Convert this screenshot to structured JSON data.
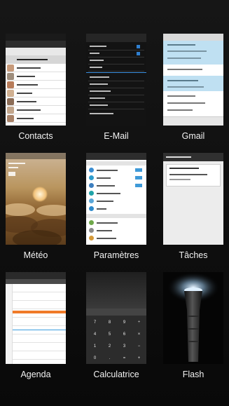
{
  "apps": [
    {
      "id": "contacts",
      "label": "Contacts"
    },
    {
      "id": "email",
      "label": "E-Mail"
    },
    {
      "id": "gmail",
      "label": "Gmail"
    },
    {
      "id": "meteo",
      "label": "Météo"
    },
    {
      "id": "parametres",
      "label": "Paramètres"
    },
    {
      "id": "taches",
      "label": "Tâches"
    },
    {
      "id": "agenda",
      "label": "Agenda"
    },
    {
      "id": "calculatrice",
      "label": "Calculatrice"
    },
    {
      "id": "flash",
      "label": "Flash"
    }
  ],
  "calculator": {
    "keys": [
      "7",
      "8",
      "9",
      "÷",
      "4",
      "5",
      "6",
      "×",
      "1",
      "2",
      "3",
      "−",
      "0",
      ".",
      "=",
      "+"
    ]
  },
  "colors": {
    "background": "#0e0e0e",
    "label": "#f2f2f2",
    "accent_blue": "#2f7fd0",
    "agenda_event": "#f07a28"
  }
}
